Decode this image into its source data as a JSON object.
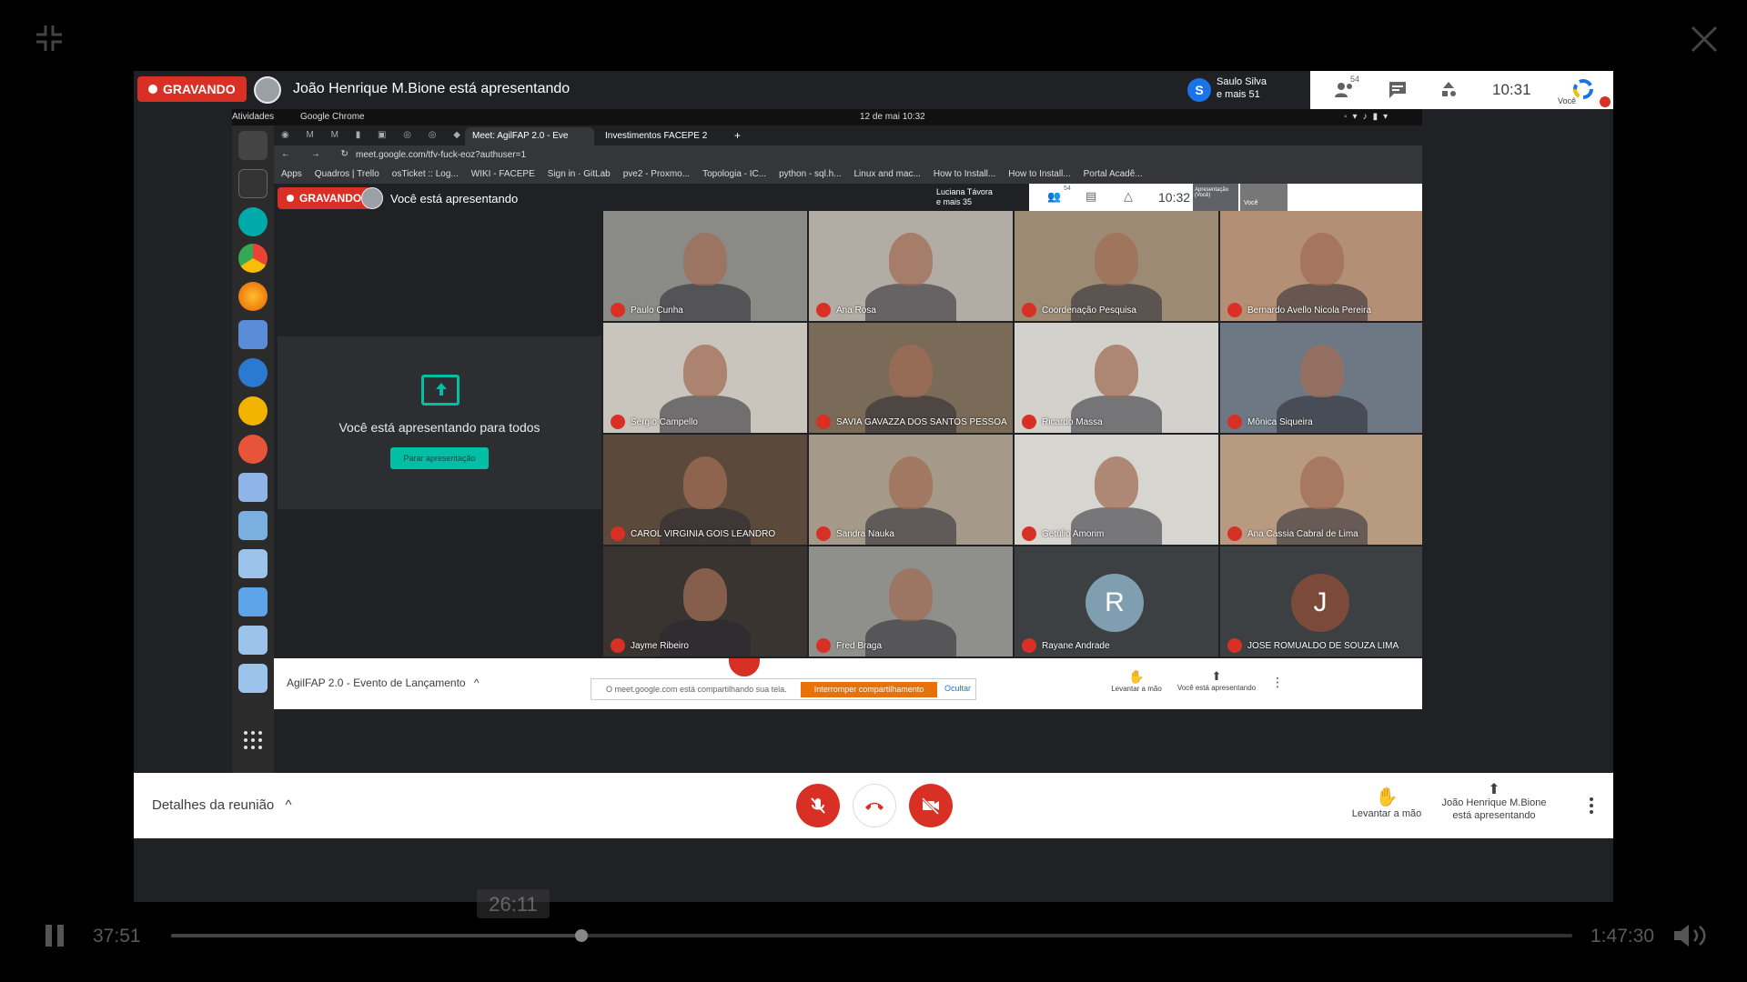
{
  "player": {
    "current_time": "37:51",
    "total_time": "1:47:30",
    "seek_tooltip": "26:11",
    "progress_fraction": 0.293
  },
  "outer_meet": {
    "recording_label": "GRAVANDO",
    "presenter_text": "João Henrique M.Bione está apresentando",
    "people_initial": "S",
    "people_name": "Saulo Silva",
    "people_more": "e mais 51",
    "participant_count": "54",
    "clock": "10:31",
    "you_label": "Você",
    "details_label": "Detalhes da reunião",
    "raise_hand": "Levantar a mão",
    "presenting_line1": "João Henrique M.Bione",
    "presenting_line2": "está apresentando"
  },
  "desktop": {
    "activities": "Atividades",
    "app_name": "Google Chrome",
    "date_time": "12 de mai  10:32"
  },
  "chrome": {
    "tab1": "Meet: AgilFAP 2.0 - Eve",
    "tab2": "Investimentos FACEPE 2",
    "url": "meet.google.com/tfv-fuck-eoz?authuser=1",
    "bookmarks": [
      "Apps",
      "Quadros | Trello",
      "osTicket :: Log...",
      "WIKI - FACEPE",
      "Sign in · GitLab",
      "pve2 - Proxmo...",
      "Topologia - IC...",
      "python - sql.h...",
      "Linux and mac...",
      "How to Install...",
      "How to Install...",
      "Portal Acadê..."
    ]
  },
  "inner_meet": {
    "recording_label": "GRAVANDO",
    "presenter_text": "Você está apresentando",
    "people_name": "Luciana Távora",
    "people_more": "e mais 35",
    "participant_count": "54",
    "clock": "10:32",
    "presentation_label": "Apresentação (Você)",
    "you_label": "Você",
    "present_message": "Você está apresentando para todos",
    "stop_presenting": "Parar apresentação",
    "meeting_title": "AgilFAP 2.0 - Evento de Lançamento",
    "share_message": "O meet.google.com está compartilhando sua tela.",
    "share_stop": "Interromper compartilhamento",
    "share_hide": "Ocultar",
    "raise_hand": "Levantar a mão",
    "you_presenting": "Você está apresentando"
  },
  "participants": [
    {
      "name": "Paulo Cunha",
      "type": "video",
      "bg": "#8a8a86"
    },
    {
      "name": "Ana Rosa",
      "type": "video",
      "bg": "#b3aca4"
    },
    {
      "name": "Coordenação Pesquisa",
      "type": "video",
      "bg": "#9c8a74"
    },
    {
      "name": "Bernardo Avello Nicola Pereira",
      "type": "video",
      "bg": "#b39075"
    },
    {
      "name": "Sergio Campello",
      "type": "video",
      "bg": "#c9c4bc"
    },
    {
      "name": "SAVIA GAVAZZA DOS SANTOS PESSOA",
      "type": "video",
      "bg": "#7a6a58"
    },
    {
      "name": "Ricardo Massa",
      "type": "video",
      "bg": "#d2d1cc"
    },
    {
      "name": "Mônica Siqueira",
      "type": "video",
      "bg": "#6d7884"
    },
    {
      "name": "CAROL VIRGINIA GOIS LEANDRO",
      "type": "video",
      "bg": "#5b4a3c"
    },
    {
      "name": "Sandra Nauka",
      "type": "video",
      "bg": "#a59a8a"
    },
    {
      "name": "Getúlio Amorim",
      "type": "video",
      "bg": "#d7d5cf"
    },
    {
      "name": "Ana Cássia Cabral de Lima",
      "type": "video",
      "bg": "#b79a80"
    },
    {
      "name": "Jayme Ribeiro",
      "type": "video",
      "bg": "#3a3430"
    },
    {
      "name": "Fred Braga",
      "type": "video",
      "bg": "#8f8f8b"
    },
    {
      "name": "Rayane Andrade",
      "type": "avatar",
      "letter": "R",
      "bg": "#3c4043",
      "avatar_color": "#7f9eaf"
    },
    {
      "name": "JOSE ROMUALDO DE SOUZA LIMA",
      "type": "avatar",
      "letter": "J",
      "bg": "#3c4043",
      "avatar_color": "#7b4a3a"
    }
  ],
  "colors": {
    "recording_red": "#d93025",
    "teal": "#00bfa5",
    "meet_dark": "#202124"
  }
}
